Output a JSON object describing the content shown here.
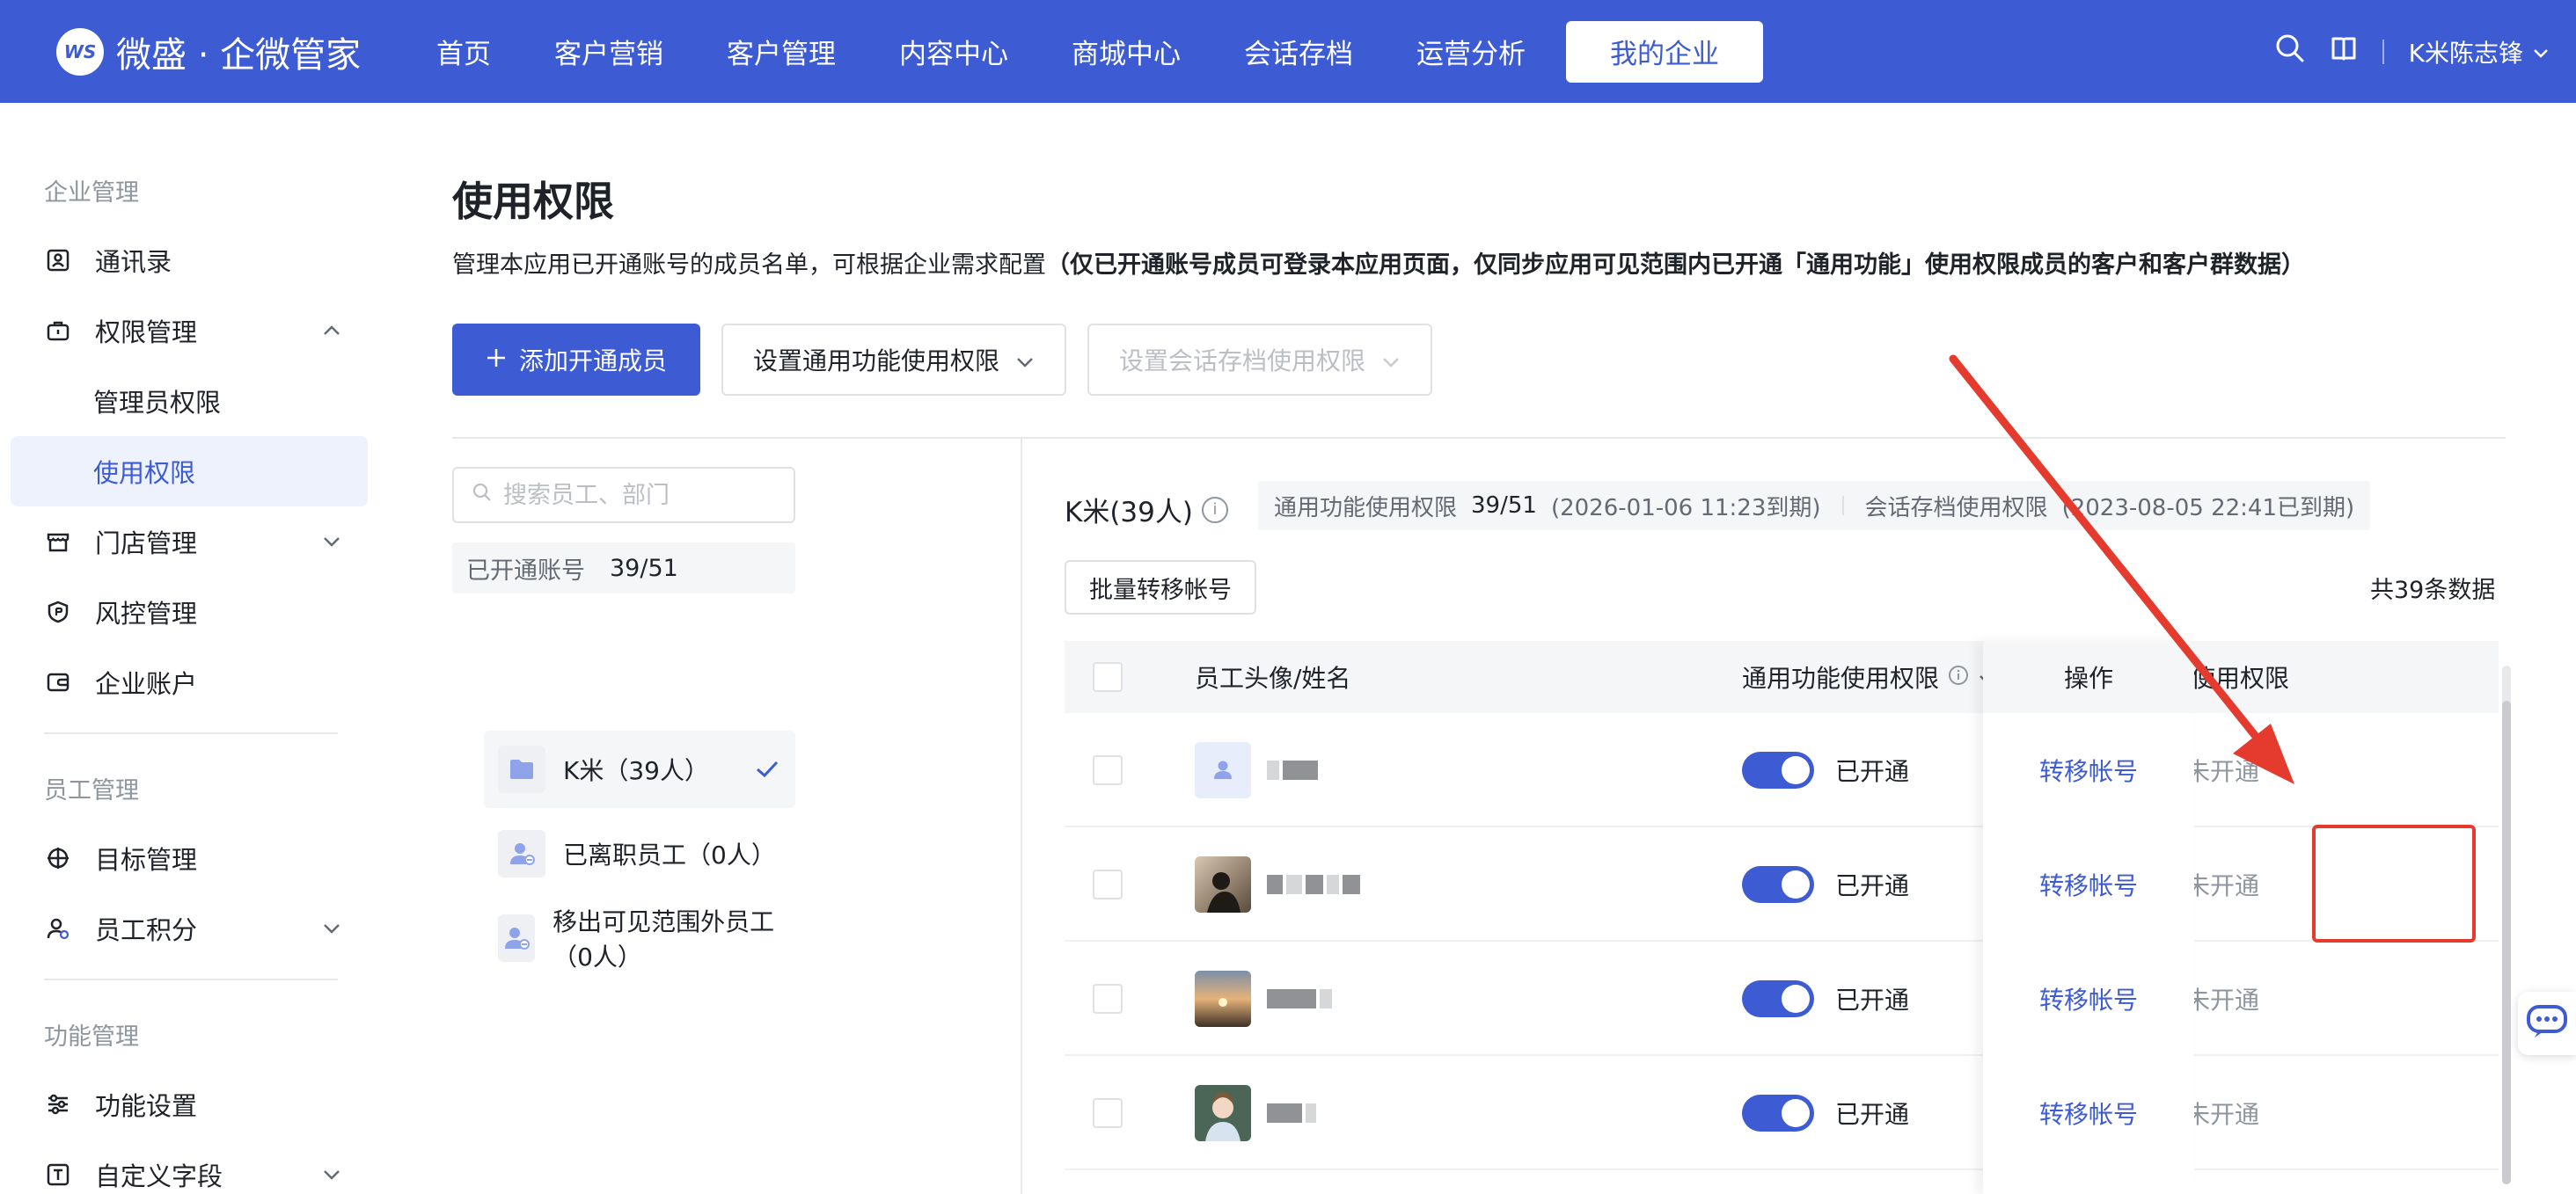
{
  "app": {
    "logo_badge": "WS",
    "logo_text": "微盛 · 企微管家"
  },
  "nav": {
    "items": [
      "首页",
      "客户营销",
      "客户管理",
      "内容中心",
      "商城中心",
      "会话存档",
      "运营分析",
      "我的企业"
    ],
    "active": "我的企业",
    "user": "K米陈志锋"
  },
  "sidebar": {
    "groups": {
      "enterprise": "企业管理",
      "staff": "员工管理",
      "feature": "功能管理"
    },
    "items": {
      "contacts": "通讯录",
      "permission": "权限管理",
      "admin_permission": "管理员权限",
      "usage_permission": "使用权限",
      "store": "门店管理",
      "risk": "风控管理",
      "account": "企业账户",
      "target": "目标管理",
      "points": "员工积分",
      "settings": "功能设置",
      "custom_fields": "自定义字段"
    }
  },
  "page": {
    "title": "使用权限",
    "desc_plain": "管理本应用已开通账号的成员名单，可根据企业需求配置",
    "desc_bold": "（仅已开通账号成员可登录本应用页面，仅同步应用可见范围内已开通「通用功能」使用权限成员的客户和客户群数据）",
    "add_button": "添加开通成员",
    "general_perm_button": "设置通用功能使用权限",
    "archive_perm_button": "设置会话存档使用权限"
  },
  "left_panel": {
    "search_placeholder": "搜索员工、部门",
    "opened_label": "已开通账号",
    "opened_value": "39/51",
    "groups": [
      "K米（39人）",
      "已离职员工（0人）",
      "移出可见范围外员工（0人）"
    ]
  },
  "right_panel": {
    "dept_title": "K米(39人)",
    "general_quota_label": "通用功能使用权限",
    "general_quota_value": "39/51",
    "general_quota_expiry": "(2026-01-06 11:23到期)",
    "archive_quota_label": "会话存档使用权限",
    "archive_quota_expiry": "(2023-08-05 22:41已到期)",
    "batch_button": "批量转移帐号",
    "total": "共39条数据"
  },
  "table": {
    "headers": {
      "name": "员工头像/姓名",
      "general": "通用功能使用权限",
      "archive": "会话存档使用权限",
      "ops": "操作"
    },
    "rows": [
      {
        "general_state": "已开通",
        "archive_state": "未开通",
        "op": "转移帐号"
      },
      {
        "general_state": "已开通",
        "archive_state": "未开通",
        "op": "转移帐号"
      },
      {
        "general_state": "已开通",
        "archive_state": "未开通",
        "op": "转移帐号"
      },
      {
        "general_state": "已开通",
        "archive_state": "未开通",
        "op": "转移帐号"
      }
    ]
  },
  "colors": {
    "brand": "#3d5bd3",
    "annotation": "#e53a2e"
  }
}
